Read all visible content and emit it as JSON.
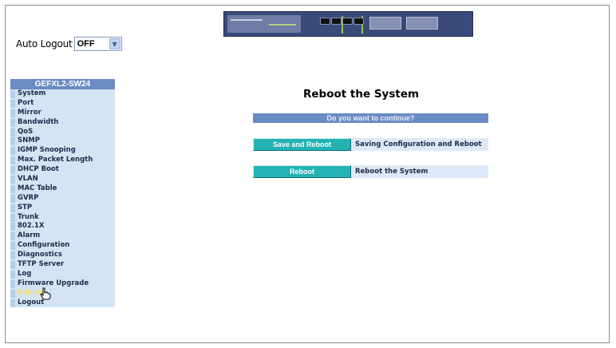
{
  "auto_logout": {
    "label": "Auto Logout",
    "value": "OFF",
    "arrow_icon": "chevron-down-icon"
  },
  "sidebar": {
    "header": "GEFXL2-SW24",
    "items": [
      {
        "label": "System"
      },
      {
        "label": "Port"
      },
      {
        "label": "Mirror"
      },
      {
        "label": "Bandwidth"
      },
      {
        "label": "QoS"
      },
      {
        "label": "SNMP"
      },
      {
        "label": "IGMP Snooping"
      },
      {
        "label": "Max. Packet Length"
      },
      {
        "label": "DHCP Boot"
      },
      {
        "label": "VLAN"
      },
      {
        "label": "MAC Table"
      },
      {
        "label": "GVRP"
      },
      {
        "label": "STP"
      },
      {
        "label": "Trunk"
      },
      {
        "label": "802.1X"
      },
      {
        "label": "Alarm"
      },
      {
        "label": "Configuration"
      },
      {
        "label": "Diagnostics"
      },
      {
        "label": "TFTP Server"
      },
      {
        "label": "Log"
      },
      {
        "label": "Firmware Upgrade"
      },
      {
        "label": "Reboot",
        "active": true
      },
      {
        "label": "Logout"
      }
    ]
  },
  "main": {
    "title": "Reboot the System",
    "question": "Do you want to continue?",
    "actions": [
      {
        "button": "Save and Reboot",
        "description": "Saving Configuration and Reboot"
      },
      {
        "button": "Reboot",
        "description": "Reboot the System"
      }
    ]
  },
  "colors": {
    "sidebar_bg": "#d5e4f3",
    "header_bg": "#6a8cc4",
    "button_bg": "#23b3b4",
    "active_item": "#f1e07a"
  }
}
